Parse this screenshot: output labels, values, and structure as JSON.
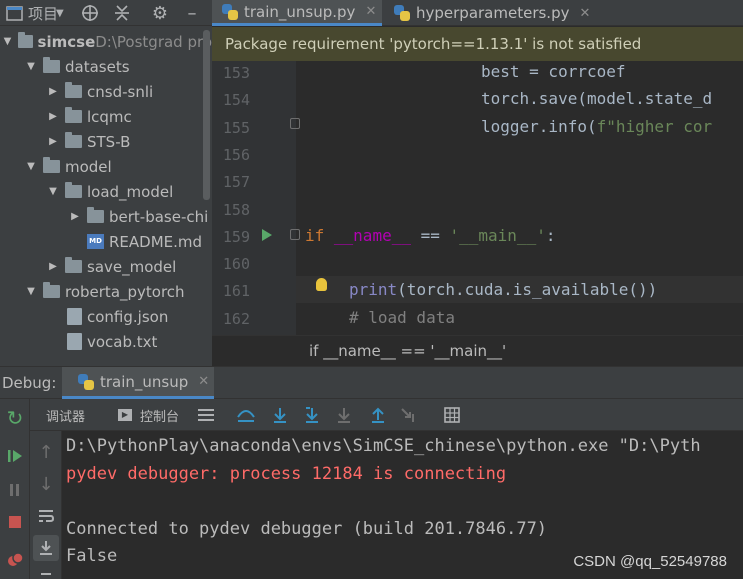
{
  "project": {
    "title": "项目",
    "tree": [
      {
        "label": "simcse",
        "extra": "D:\\Postgrad pro",
        "type": "folder",
        "open": true,
        "indent": 0,
        "bold": true
      },
      {
        "label": "datasets",
        "type": "folder",
        "open": true,
        "indent": 1
      },
      {
        "label": "cnsd-snli",
        "type": "folder",
        "open": false,
        "indent": 2
      },
      {
        "label": "lcqmc",
        "type": "folder",
        "open": false,
        "indent": 2
      },
      {
        "label": "STS-B",
        "type": "folder",
        "open": false,
        "indent": 2
      },
      {
        "label": "model",
        "type": "folder",
        "open": true,
        "indent": 1
      },
      {
        "label": "load_model",
        "type": "folder",
        "open": true,
        "indent": 2
      },
      {
        "label": "bert-base-chi",
        "type": "folder",
        "open": false,
        "indent": 3
      },
      {
        "label": "README.md",
        "type": "md",
        "indent": 3
      },
      {
        "label": "save_model",
        "type": "folder",
        "open": false,
        "indent": 2
      },
      {
        "label": "roberta_pytorch",
        "type": "folder",
        "open": true,
        "indent": 1
      },
      {
        "label": "config.json",
        "type": "file",
        "indent": 2
      },
      {
        "label": "vocab.txt",
        "type": "file",
        "indent": 2
      }
    ]
  },
  "tabs": [
    {
      "label": "train_unsup.py",
      "active": true
    },
    {
      "label": "hyperparameters.py",
      "active": false
    }
  ],
  "notice": "Package requirement 'pytorch==1.13.1' is not satisfied",
  "editor": {
    "lines": [
      {
        "n": "153",
        "code": "best = corrcoef"
      },
      {
        "n": "154",
        "code": "torch.save(model.state_d"
      },
      {
        "n": "155",
        "code": "logger.info(f\"higher cor"
      },
      {
        "n": "156",
        "code": ""
      },
      {
        "n": "157",
        "code": ""
      },
      {
        "n": "158",
        "code": ""
      },
      {
        "n": "159",
        "code": "if __name__ == '__main__':"
      },
      {
        "n": "160",
        "code": ""
      },
      {
        "n": "161",
        "code": "print(torch.cuda.is_available())"
      },
      {
        "n": "162",
        "code": "# load data"
      }
    ],
    "breadcrumb": "if __name__ == '__main__'"
  },
  "debug": {
    "label": "Debug:",
    "session_tab": "train_unsup",
    "debugger_tab": "调试器",
    "console_tab": "控制台",
    "console": [
      {
        "text": "D:\\PythonPlay\\anaconda\\envs\\SimCSE_chinese\\python.exe \"D:\\Pyth",
        "color": "#bbbbbb"
      },
      {
        "text": "pydev debugger: process 12184 is connecting",
        "color": "#ff6b68"
      },
      {
        "text": "",
        "color": "#bbbbbb"
      },
      {
        "text": "Connected to pydev debugger (build 201.7846.77)",
        "color": "#bbbbbb"
      },
      {
        "text": "False",
        "color": "#bbbbbb"
      }
    ]
  },
  "watermark": "CSDN @qq_52549788",
  "colors": {
    "accent": "#4a88c7",
    "error": "#ff6b68",
    "keyword": "#cc7832",
    "string": "#6a8759"
  }
}
